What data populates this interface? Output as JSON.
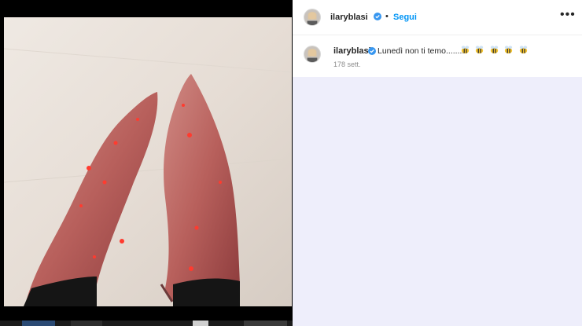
{
  "post": {
    "username": "ilaryblasi",
    "separator": "•",
    "follow_label": "Segui",
    "more_label": "•••",
    "caption_text": "Lunedì non ti temo........",
    "caption_emoji_count": 5,
    "caption_emoji_icon": "bee-icon",
    "timestamp": "178 sett."
  },
  "colors": {
    "accent": "#0095f6",
    "verified": "#3897f0",
    "comments_bg": "#eeeefb"
  }
}
